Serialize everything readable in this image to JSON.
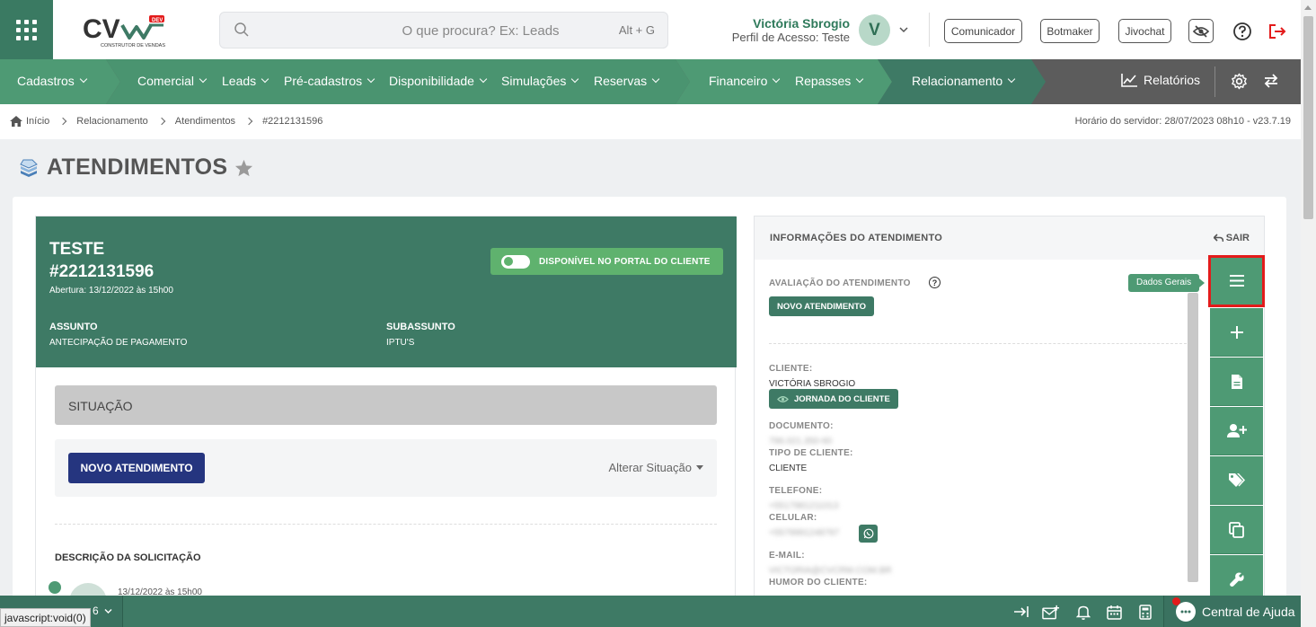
{
  "header": {
    "brand_tag": "DEV",
    "brand_tagline": "CONSTRUTOR DE VENDAS",
    "search_placeholder": "O que procura? Ex: Leads",
    "search_shortcut": "Alt + G",
    "user_name": "Victória Sbrogio",
    "user_profile": "Perfil de Acesso: Teste",
    "avatar_letter": "V",
    "buttons": {
      "comunicador": "Comunicador",
      "botmaker": "Botmaker",
      "jivochat": "Jivochat"
    }
  },
  "nav": {
    "items": [
      "Cadastros",
      "Comercial",
      "Leads",
      "Pré-cadastros",
      "Disponibilidade",
      "Simulações",
      "Reservas",
      "Financeiro",
      "Repasses",
      "Relacionamento"
    ],
    "reports": "Relatórios"
  },
  "breadcrumb": {
    "items": [
      "Início",
      "Relacionamento",
      "Atendimentos",
      "#2212131596"
    ],
    "server_time": "Horário do servidor: 28/07/2023 08h10 - v23.7.19"
  },
  "page": {
    "title": "ATENDIMENTOS"
  },
  "ticket": {
    "name": "TESTE",
    "number": "#2212131596",
    "opened": "Abertura: 13/12/2022 às 15h00",
    "portal_badge": "DISPONÍVEL NO PORTAL DO CLIENTE",
    "subject_label": "ASSUNTO",
    "subject_value": "ANTECIPAÇÃO DE PAGAMENTO",
    "subsubject_label": "SUBASSUNTO",
    "subsubject_value": "IPTU'S",
    "situation_label": "SITUAÇÃO",
    "status_button": "NOVO ATENDIMENTO",
    "change_situation": "Alterar Situação",
    "description_label": "DESCRIÇÃO DA SOLICITAÇÃO",
    "timeline_date": "13/12/2022 às 15h00"
  },
  "info": {
    "title": "INFORMAÇÕES DO ATENDIMENTO",
    "exit": "SAIR",
    "rating_label": "AVALIAÇÃO DO ATENDIMENTO",
    "rating_pill": "NOVO ATENDIMENTO",
    "client_label": "CLIENTE:",
    "client_value": "VICTÓRIA SBROGIO",
    "journey_pill": "JORNADA DO CLIENTE",
    "document_label": "DOCUMENTO:",
    "document_value": "796.021.350-60",
    "client_type_label": "TIPO DE CLIENTE:",
    "client_type_value": "CLIENTE",
    "phone_label": "TELEFONE:",
    "phone_value": "+5517981211013",
    "mobile_label": "CELULAR:",
    "mobile_value": "+5579991248797",
    "email_label": "E-MAIL:",
    "email_value": "VICTORIA@CVCRM.COM.BR",
    "mood_label": "HUMOR DO CLIENTE:"
  },
  "side": {
    "tooltip": "Dados Gerais"
  },
  "bottom": {
    "left_text": "6",
    "status_url": "javascript:void(0)",
    "help_center": "Central de Ajuda"
  },
  "colors": {
    "brand_green": "#3e7a65",
    "accent_green": "#4e9a74",
    "navy": "#25357f",
    "nav_gray": "#5c5c5c",
    "highlight_red": "#e31b1b"
  }
}
